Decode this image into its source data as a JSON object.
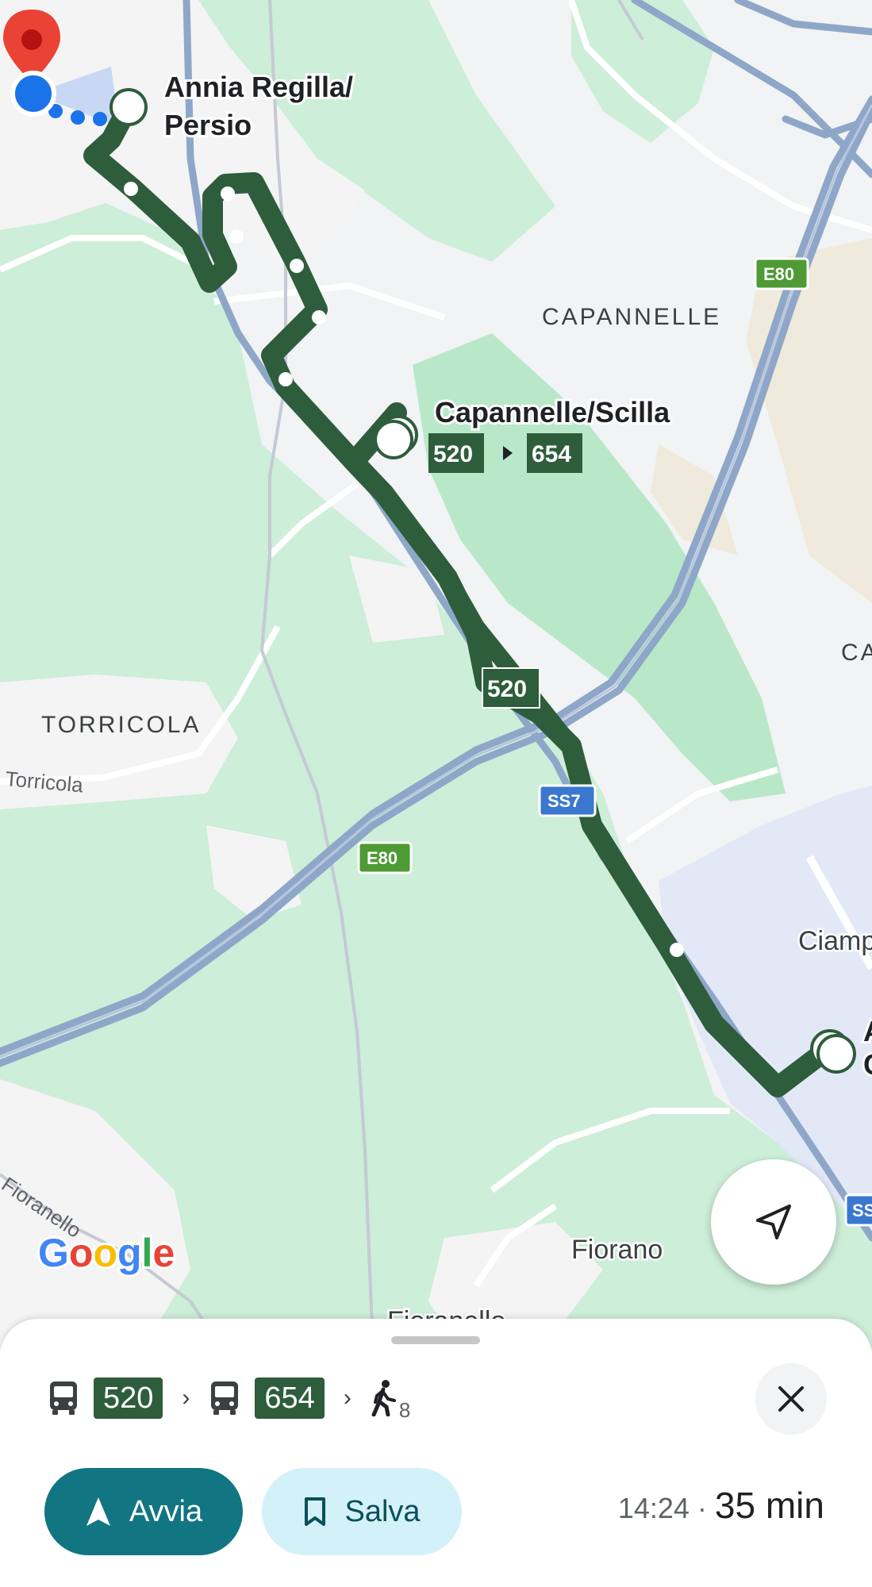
{
  "map": {
    "stops": {
      "origin_name_line1": "Annia Regilla/",
      "origin_name_line2": "Persio",
      "transfer_name": "Capannelle/Scilla",
      "transfer_from_line": "520",
      "transfer_to_line": "654",
      "destination_partial_line1": "A",
      "destination_partial_line2": "C"
    },
    "places": {
      "capannelle": "CAPANNELLE",
      "torricola": "TORRICOLA",
      "ca_partial": "CA",
      "ciampino_partial": "Ciamp",
      "fiorano": "Fiorano",
      "fioranello_bottom": "Fioranello"
    },
    "roads": {
      "torricola_road": "Torricola",
      "fioranello_road": "Fioranello"
    },
    "shields": {
      "e80_top": "E80",
      "e80_mid": "E80",
      "ss7": "SS7",
      "ss_partial": "SS"
    },
    "route_badge": "520",
    "attribution": "Google",
    "colors": {
      "route": "#2e5d3c",
      "park": "#cdeed8",
      "land": "#f1f3f4",
      "airport": "#e3e8f6",
      "highway": "#8ea7c9",
      "origin_marker": "#ea4335",
      "location_dot": "#1a73e8"
    }
  },
  "controls": {
    "locate_icon": "navigation-arrow-icon"
  },
  "sheet": {
    "legs": [
      {
        "mode_icon": "bus-icon",
        "line": "520"
      },
      {
        "mode_icon": "bus-icon",
        "line": "654"
      }
    ],
    "walk_icon": "walk-icon",
    "walk_minutes": "8",
    "chevron": "›",
    "close_icon": "close-icon",
    "start_label": "Avvia",
    "start_icon": "navigation-arrow-icon",
    "save_label": "Salva",
    "save_icon": "bookmark-icon",
    "arrival_time": "14:24",
    "separator": "·",
    "duration": "35 min"
  }
}
